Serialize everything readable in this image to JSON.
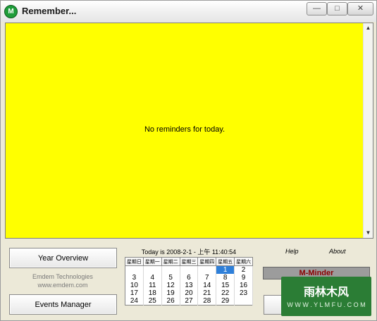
{
  "window": {
    "title": "Remember...",
    "app_icon": "M",
    "minimize_glyph": "—",
    "maximize_glyph": "□",
    "close_glyph": "✕"
  },
  "main": {
    "message": "No reminders for today.",
    "background_color": "#ffff00"
  },
  "left_panel": {
    "year_overview": "Year Overview",
    "company": "Emdem Technologies",
    "url": "www.emdem.com",
    "events_manager": "Events Manager"
  },
  "calendar": {
    "today_label": "Today is 2008-2-1 - 上午 11:40:54",
    "weekdays": [
      "星期日",
      "星期一",
      "星期二",
      "星期三",
      "星期四",
      "星期五",
      "星期六"
    ],
    "weeks": [
      [
        "",
        "",
        "",
        "",
        "",
        "1",
        "2"
      ],
      [
        "3",
        "4",
        "5",
        "6",
        "7",
        "8",
        "9"
      ],
      [
        "10",
        "11",
        "12",
        "13",
        "14",
        "15",
        "16"
      ],
      [
        "17",
        "18",
        "19",
        "20",
        "21",
        "22",
        "23"
      ],
      [
        "24",
        "25",
        "26",
        "27",
        "28",
        "29",
        ""
      ]
    ],
    "selected_day": "1"
  },
  "right_panel": {
    "help": "Help",
    "about": "About",
    "brand": "M-Minder"
  },
  "watermark": {
    "text": "雨林木风",
    "url": "W W W . Y L M F U . C O M"
  },
  "colors": {
    "accent": "#ffff00",
    "selected": "#2e7fd9",
    "brand": "#8b0000"
  }
}
